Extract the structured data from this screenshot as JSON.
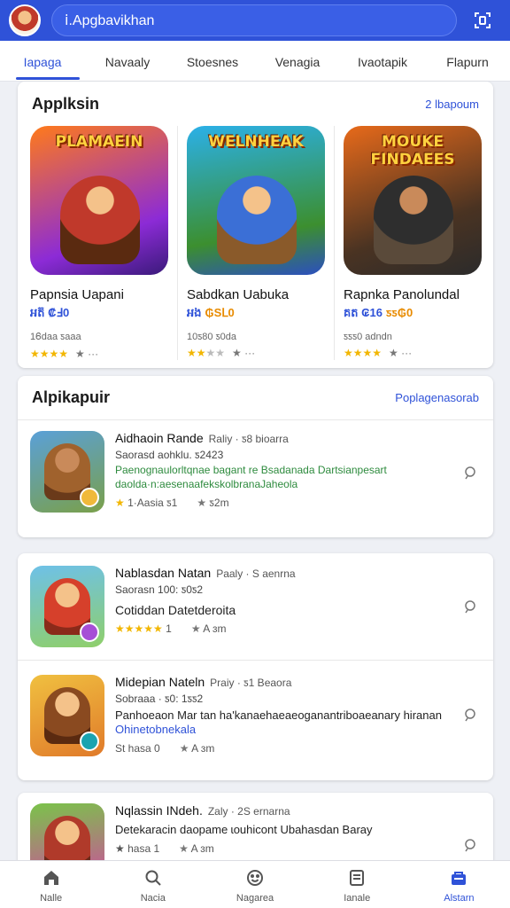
{
  "search": {
    "placeholder": "ⅰ.Apgbavikhan"
  },
  "tabs": [
    {
      "label": "Iapaga"
    },
    {
      "label": "Navaaly"
    },
    {
      "label": "Stoesnes"
    },
    {
      "label": "Venagia"
    },
    {
      "label": "Ivaotapik"
    },
    {
      "label": "Flapurn"
    }
  ],
  "featured": {
    "title": "Applksin",
    "link": "2 lbapoum",
    "apps": [
      {
        "banner": "PLAMAEIN",
        "name": "Papnsia Uapani",
        "price": "អត៊ ₡Ⅎ0",
        "meta": "1Ꮾdaa ƽaaa",
        "stars": "★★★★",
        "dim_stars": "",
        "extra": "★ ···",
        "colors": [
          "#ff7a1a",
          "#8c2bd6",
          "#c0392b"
        ]
      },
      {
        "banner": "WELNHEAK",
        "name": "Sabdkan Uabuka",
        "price": "អង",
        "sale": "₲SⅬ0",
        "meta": "10ƽ80 ƽ0da",
        "stars": "★★",
        "dim_stars": "★★",
        "extra": "★ ···",
        "colors": [
          "#2bb0e8",
          "#3c8f2f",
          "#2c4fbf"
        ]
      },
      {
        "banner": "MOUKE FINDAEES",
        "name": "Rapnka Panolundal",
        "price": "គត ₢16",
        "sale": "ƽƽ₲0",
        "meta": "ƽƽƽ0 adndn",
        "stars": "★★★★",
        "dim_stars": "",
        "extra": "★ ···",
        "colors": [
          "#e86a1a",
          "#4a3322",
          "#2b2b2b"
        ]
      }
    ]
  },
  "list": {
    "title": "Alpikapuir",
    "link": "Poplagenasorab",
    "items": [
      {
        "name": "Aidhaoin Rande",
        "sub": "Raliy · ƽ8 bioarra",
        "line": "Saorasd aohklu. ƽ2423",
        "green": "Paenognaulorltqnae bagant re Bsadanada Dartsianpesart daolda·n:aesenaafekskolbranaJaheola",
        "rating": "1·Aasia ƽ1",
        "rating2": "ƽ2m",
        "stars": "★",
        "colors": [
          "#5aa0d8",
          "#a0622d",
          "#f0b93a"
        ]
      }
    ]
  },
  "list2": {
    "items": [
      {
        "name": "Nablasdan Natan",
        "sub": "Paaly · S aenrna",
        "line": "Saorasn 100: ƽ0ƽ2",
        "desc": "Cotiddan Datetderoita",
        "blue": "",
        "stars": "★★★★★",
        "rating": "1",
        "rating2": "A ɜm",
        "colors": [
          "#6ec1e8",
          "#d6402b",
          "#a64fd6"
        ]
      },
      {
        "name": "Midepian Nateln",
        "sub": "Praiy · ƽ1 Beaora",
        "line": "Sobraaa · ƽ0: 1ƽƽ2",
        "desc": "Panhoeaon Mar tan ha'kanaehaeaeoganantriboaeanary hiranan",
        "blue": "Ohinetobnekala",
        "stars": "",
        "rating": "St hasa 0",
        "rating2": "A ɜm",
        "colors": [
          "#f0c040",
          "#8a4a20",
          "#1aa3b0"
        ]
      }
    ]
  },
  "list3": {
    "items": [
      {
        "name": "Nqlassin INdeh.",
        "sub": "Zaly · 2S ernarna",
        "line": "Detekaracin daopame ɩouhicont Ubahasdan Baray",
        "stars": "",
        "rating": "★ hasa 1",
        "rating2": "A ɜm",
        "colors": [
          "#7ac34a",
          "#b03a2a",
          "#d04aa0"
        ]
      }
    ]
  },
  "bottom_nav": [
    {
      "label": "Nalle",
      "icon": "home-icon",
      "glyph": "⌂"
    },
    {
      "label": "Nacia",
      "icon": "search-icon",
      "glyph": "⌕"
    },
    {
      "label": "Nagarea",
      "icon": "smiley-icon",
      "glyph": "☺"
    },
    {
      "label": "Ianale",
      "icon": "list-icon",
      "glyph": "▤"
    },
    {
      "label": "Alstarn",
      "icon": "bag-icon",
      "glyph": "▭",
      "active": true
    }
  ],
  "theme": {
    "accent": "#2f52d8",
    "star": "#f2b600",
    "green_text": "#2e8b3e",
    "sale": "#e88b00"
  }
}
